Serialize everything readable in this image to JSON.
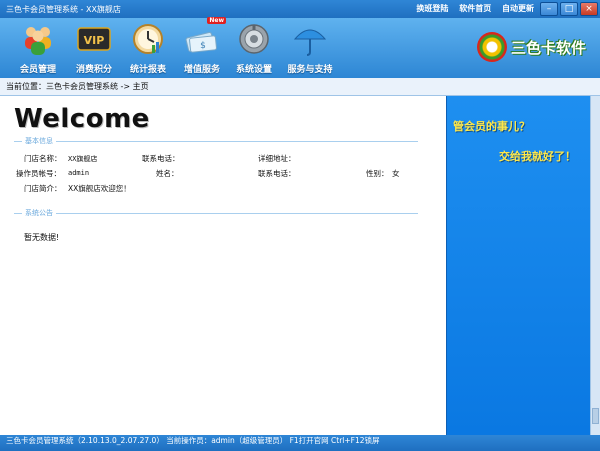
{
  "window": {
    "title": "三色卡会员管理系统 - XX旗舰店",
    "links": [
      "换班登陆",
      "软件首页",
      "自动更新"
    ],
    "buttons": {
      "minimize": "–",
      "maximize": "□",
      "close": "×"
    }
  },
  "toolbar": {
    "items": [
      {
        "label": "会员管理",
        "icon": "people-icon"
      },
      {
        "label": "消费积分",
        "icon": "vip-card-icon"
      },
      {
        "label": "统计报表",
        "icon": "clock-chart-icon"
      },
      {
        "label": "增值服务",
        "icon": "money-bills-icon"
      },
      {
        "label": "系统设置",
        "icon": "gear-knob-icon"
      },
      {
        "label": "服务与支持",
        "icon": "umbrella-icon"
      }
    ],
    "new_badge": "New",
    "logo_text": "三色卡软件"
  },
  "breadcrumb": "当前位置：三色卡会员管理系统 -> 主页",
  "main": {
    "welcome": "Welcome",
    "basic_section_title": "基本信息",
    "fields": {
      "store_name_label": "门店名称：",
      "store_name_value": "XX旗舰店",
      "store_phone_label": "联系电话：",
      "address_label": "详细地址：",
      "operator_label": "操作员帐号：",
      "operator_value": "admin",
      "name_label": "姓名：",
      "operator_phone_label": "联系电话：",
      "gender_label": "性别：",
      "gender_value": "女",
      "intro_label": "门店简介：",
      "intro_value": "XX旗舰店欢迎您！"
    },
    "notice_section_title": "系统公告",
    "notice_empty": "暂无数据!"
  },
  "banner": {
    "line1": "管会员的事儿？",
    "line2": "交给我就好了！"
  },
  "status": "三色卡会员管理系统（2.10.13.0_2.07.27.0）  当前操作员：admin（超级管理员）  F1打开官网 Ctrl+F12锁屏"
}
